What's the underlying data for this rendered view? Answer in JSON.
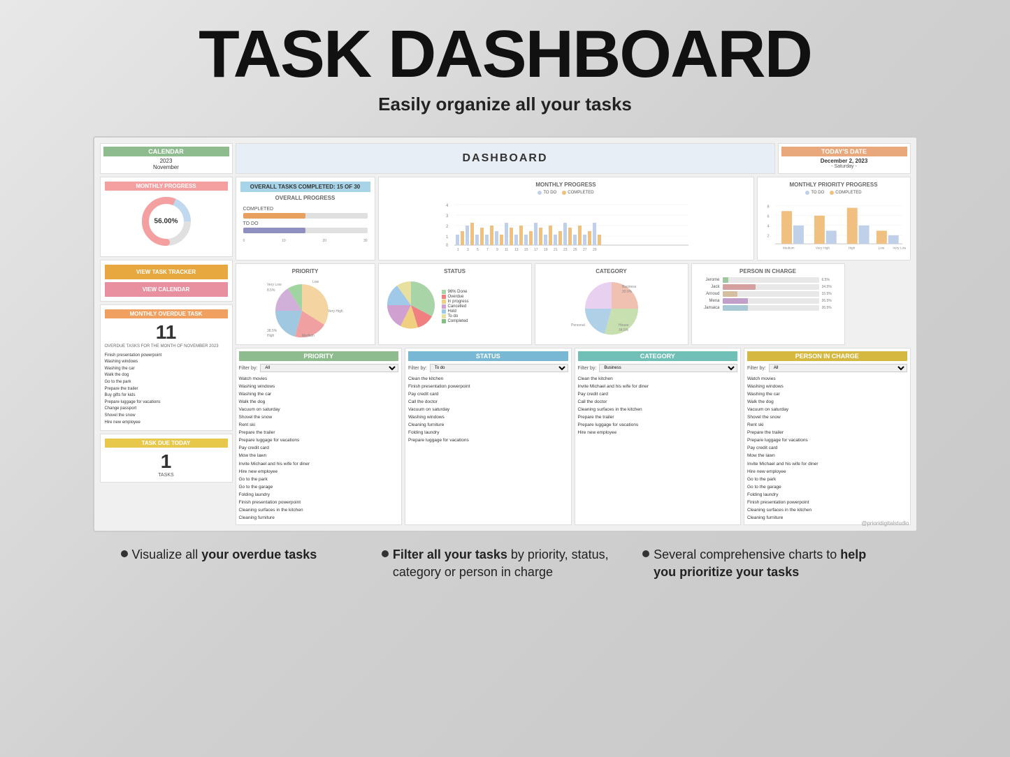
{
  "page": {
    "title": "TASK DASHBOARD",
    "subtitle": "Easily organize all your tasks"
  },
  "calendar": {
    "header": "CALENDAR",
    "year": "2023",
    "month": "November"
  },
  "dashboard": {
    "title": "DASHBOARD"
  },
  "today": {
    "header": "TODAY'S DATE",
    "date": "December 2, 2023",
    "day": "- Saturday -"
  },
  "monthly_progress": {
    "header": "MONTHLY PROGRESS",
    "percent": "56.00%"
  },
  "overall_tasks": {
    "header": "OVERALL TASKS COMPLETED: 15 OF 30"
  },
  "overall_progress": {
    "title": "OVERALL PROGRESS",
    "completed_label": "COMPLETED",
    "todo_label": "TO DO",
    "completed_value": 15,
    "todo_value": 15
  },
  "monthly_progress_chart": {
    "title": "MONTHLY PROGRESS",
    "legend_todo": "TO DO",
    "legend_completed": "COMPLETED"
  },
  "monthly_priority": {
    "title": "MONTHLY PRIORITY PROGRESS",
    "legend_todo": "TO DO",
    "legend_completed": "COMPLETED"
  },
  "buttons": {
    "view_tracker": "VIEW TASK TRACKER",
    "view_calendar": "VIEW CALENDAR"
  },
  "overdue": {
    "header": "MONTHLY OVERDUE TASK",
    "count": "11",
    "subtitle": "OVERDUE TASKS FOR THE MONTH OF NOVEMBER 2023",
    "tasks": [
      "Finish presentation powerpoint",
      "Washing windows",
      "Washing the car",
      "Walk the dog",
      "Go to the park",
      "Prepare the trailer",
      "Buy gifts for kids",
      "Prepare luggage for vacations",
      "Change passport",
      "Shovel the snow",
      "Hire new employee"
    ]
  },
  "task_due": {
    "header": "TASK DUE TODAY",
    "count": "1",
    "label": "TASKS"
  },
  "priority_chart": {
    "title": "PRIORITY",
    "labels": [
      "Very Low",
      "Low",
      "Medium",
      "High",
      "Very High"
    ]
  },
  "status_chart": {
    "title": "STATUS",
    "items": [
      {
        "label": "96% Done",
        "color": "#a8d4a8"
      },
      {
        "label": "Overdue",
        "color": "#f08080"
      },
      {
        "label": "In progress",
        "color": "#f0d080"
      },
      {
        "label": "Cancelled",
        "color": "#d0a0d0"
      },
      {
        "label": "Hold",
        "color": "#a0c8e8"
      },
      {
        "label": "To do",
        "color": "#e8e0a0"
      },
      {
        "label": "Completed",
        "color": "#80c080"
      }
    ]
  },
  "category_chart": {
    "title": "CATEGORY",
    "labels": [
      "House",
      "Business",
      "Personal"
    ]
  },
  "person_chart": {
    "title": "PERSON IN CHARGE",
    "people": [
      {
        "name": "Jerome",
        "pct": "6.5%",
        "value": 6.5,
        "color": "#a0c8a0"
      },
      {
        "name": "Jack",
        "pct": "34.5%",
        "value": 34.5,
        "color": "#d4a0a0"
      },
      {
        "name": "Arnoud",
        "pct": "15.5%",
        "value": 15.5,
        "color": "#d4c0a0"
      },
      {
        "name": "Mena",
        "pct": "26.5%",
        "value": 26.5,
        "color": "#c0a0c8"
      },
      {
        "name": "Jamaica",
        "pct": "26.5%",
        "value": 26.5,
        "color": "#a8c8d4"
      }
    ]
  },
  "filter_priority": {
    "header": "PRIORITY",
    "filter_label": "Filter by:",
    "tasks": [
      "Watch movies",
      "Washing windows",
      "Washing the car",
      "Walk the dog",
      "Vacuum on saturday",
      "Shovel the snow",
      "Rent ski",
      "Prepare the trailer",
      "Prepare luggage for vacations",
      "Pay credit card",
      "Mow the lawn",
      "Invite Michael and his wife for diner",
      "Hire new employee",
      "Go to the park",
      "Go to the garage",
      "Folding laundry",
      "Finish presentation powerpoint",
      "Cleaning surfaces in the kitchen",
      "Cleaning furniture"
    ]
  },
  "filter_status": {
    "header": "STATUS",
    "filter_label": "Filter by:",
    "filter_value": "To do",
    "tasks": [
      "Clean the kitchen",
      "Finish presentation powerpoint",
      "Pay credit card",
      "Call the doctor",
      "Vacuum on saturday",
      "Washing windows",
      "Cleaning furniture",
      "Folding laundry",
      "Prepare luggage for vacations"
    ]
  },
  "filter_category": {
    "header": "CATEGORY",
    "filter_label": "Filter by:",
    "filter_value": "Business",
    "tasks": [
      "Clean the kitchen",
      "Invite Michael and his wife for diner",
      "Pay credit card",
      "Call the doctor",
      "Cleaning surfaces in the kitchen",
      "Prepare the trailer",
      "Prepare luggage for vacations",
      "Hire new employee"
    ]
  },
  "filter_person": {
    "header": "PERSON IN CHARGE",
    "filter_label": "Filter by:",
    "tasks": [
      "Watch movies",
      "Washing windows",
      "Washing the car",
      "Walk the dog",
      "Vacuum on saturday",
      "Shovel the snow",
      "Rent ski",
      "Prepare the trailer",
      "Prepare luggage for vacations",
      "Pay credit card",
      "Mow the lawn",
      "Invite Michael and his wife for diner",
      "Hire new employee",
      "Go to the park",
      "Go to the garage",
      "Folding laundry",
      "Finish presentation powerpoint",
      "Cleaning surfaces in the kitchen",
      "Cleaning furniture"
    ]
  },
  "annotations": {
    "left": "Visualize all your overdue tasks",
    "left_bold": "your overdue tasks",
    "center": "Filter all your tasks by priority, status, category or person in charge",
    "center_bold": "Filter all your tasks",
    "right": "Several comprehensive charts to help you prioritize your tasks",
    "right_bold": "help you prioritize your tasks"
  },
  "watermark": "@prioridigitalstudio"
}
